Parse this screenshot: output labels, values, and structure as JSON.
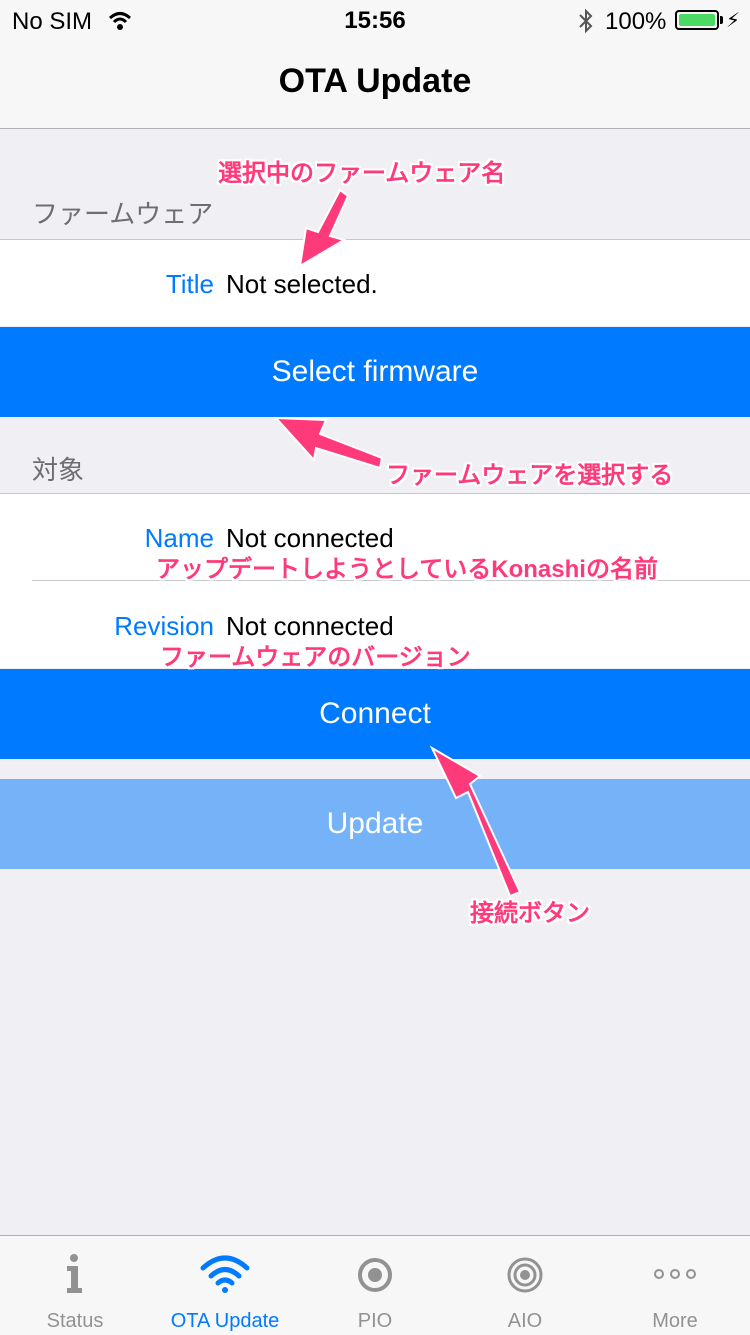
{
  "status_bar": {
    "carrier": "No SIM",
    "time": "15:56",
    "battery_percent": "100%",
    "battery_level": 1.0
  },
  "nav": {
    "title": "OTA Update"
  },
  "firmware_section": {
    "header": "ファームウェア",
    "title_label": "Title",
    "title_value": "Not selected.",
    "select_button": "Select firmware"
  },
  "target_section": {
    "header": "対象",
    "name_label": "Name",
    "name_value": "Not connected",
    "revision_label": "Revision",
    "revision_value": "Not connected",
    "connect_button": "Connect"
  },
  "update_button": "Update",
  "annotations": {
    "firmware_name": "選択中のファームウェア名",
    "select_firmware": "ファームウェアを選択する",
    "konashi_name": "アップデートしようとしているKonashiの名前",
    "firmware_version": "ファームウェアのバージョン",
    "connect_button": "接続ボタン"
  },
  "tabbar": {
    "tabs": [
      {
        "label": "Status",
        "icon": "info-icon"
      },
      {
        "label": "OTA Update",
        "icon": "wifi-icon"
      },
      {
        "label": "PIO",
        "icon": "pio-icon"
      },
      {
        "label": "AIO",
        "icon": "aio-icon"
      },
      {
        "label": "More",
        "icon": "more-icon"
      }
    ],
    "active_index": 1
  },
  "colors": {
    "accent": "#007aff",
    "button_primary": "#007aff",
    "button_disabled": "#75b2f8",
    "annotation": "#ff3a7a",
    "background": "#efeff4"
  }
}
